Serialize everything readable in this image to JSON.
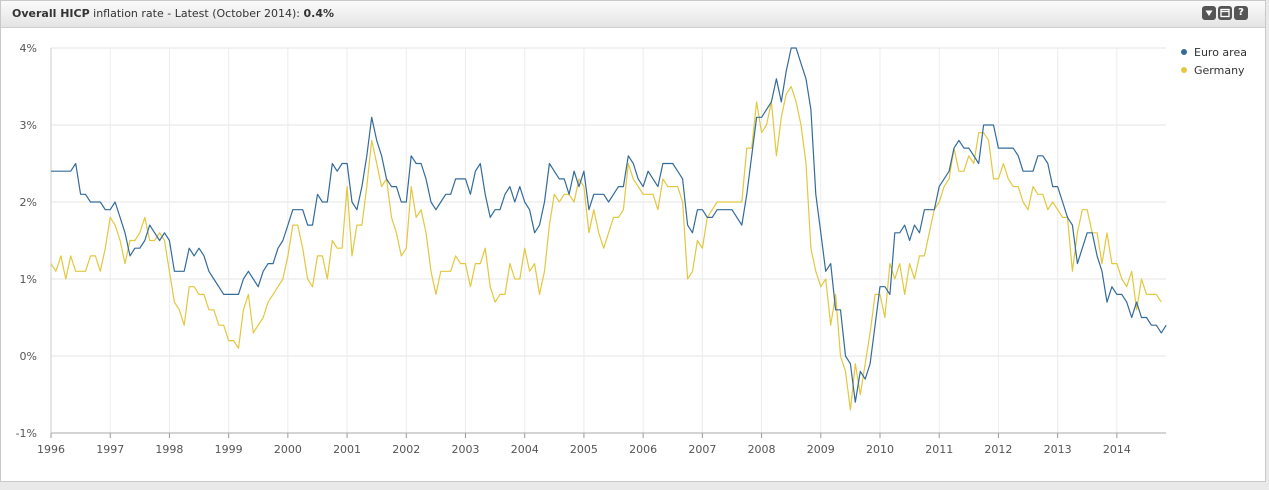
{
  "header": {
    "title_bold": "Overall HICP",
    "title_rest": " inflation rate - Latest (October 2014): ",
    "latest_value": "0.4%",
    "buttons": {
      "menu": "menu-icon",
      "window": "window-icon",
      "help": "?"
    }
  },
  "chart_data": {
    "type": "line",
    "title": "",
    "xlabel": "",
    "ylabel": "",
    "x_start": "1996-01",
    "x_end": "2014-10",
    "x_interval": "monthly",
    "xlim": [
      1996,
      2014.83
    ],
    "ylim": [
      -1,
      4
    ],
    "y_ticks": [
      "-1%",
      "0%",
      "1%",
      "2%",
      "3%",
      "4%"
    ],
    "x_ticks": [
      "1996",
      "1997",
      "1998",
      "1999",
      "2000",
      "2001",
      "2002",
      "2003",
      "2004",
      "2005",
      "2006",
      "2007",
      "2008",
      "2009",
      "2010",
      "2011",
      "2012",
      "2013",
      "2014"
    ],
    "grid": true,
    "legend_position": "top-right",
    "series": [
      {
        "name": "Euro area",
        "color": "#336b9b",
        "values": [
          2.4,
          2.4,
          2.4,
          2.4,
          2.4,
          2.5,
          2.1,
          2.1,
          2.0,
          2.0,
          2.0,
          1.9,
          1.9,
          2.0,
          1.8,
          1.6,
          1.3,
          1.4,
          1.4,
          1.5,
          1.7,
          1.6,
          1.5,
          1.6,
          1.5,
          1.1,
          1.1,
          1.1,
          1.4,
          1.3,
          1.4,
          1.3,
          1.1,
          1.0,
          0.9,
          0.8,
          0.8,
          0.8,
          0.8,
          1.0,
          1.1,
          1.0,
          0.9,
          1.1,
          1.2,
          1.2,
          1.4,
          1.5,
          1.7,
          1.9,
          1.9,
          1.9,
          1.7,
          1.7,
          2.1,
          2.0,
          2.0,
          2.5,
          2.4,
          2.5,
          2.5,
          2.0,
          1.9,
          2.2,
          2.6,
          3.1,
          2.8,
          2.6,
          2.3,
          2.2,
          2.2,
          2.0,
          2.0,
          2.6,
          2.5,
          2.5,
          2.3,
          2.0,
          1.9,
          2.0,
          2.1,
          2.1,
          2.3,
          2.3,
          2.3,
          2.1,
          2.4,
          2.5,
          2.1,
          1.8,
          1.9,
          1.9,
          2.1,
          2.2,
          2.0,
          2.2,
          2.0,
          1.9,
          1.6,
          1.7,
          2.0,
          2.5,
          2.4,
          2.3,
          2.3,
          2.1,
          2.4,
          2.2,
          2.4,
          1.9,
          2.1,
          2.1,
          2.1,
          2.0,
          2.1,
          2.2,
          2.2,
          2.6,
          2.5,
          2.3,
          2.2,
          2.4,
          2.3,
          2.2,
          2.5,
          2.5,
          2.5,
          2.4,
          2.3,
          1.7,
          1.6,
          1.9,
          1.9,
          1.8,
          1.8,
          1.9,
          1.9,
          1.9,
          1.9,
          1.8,
          1.7,
          2.1,
          2.6,
          3.1,
          3.1,
          3.2,
          3.3,
          3.6,
          3.3,
          3.7,
          4.0,
          4.0,
          3.8,
          3.6,
          3.2,
          2.1,
          1.6,
          1.1,
          1.2,
          0.6,
          0.6,
          0.0,
          -0.1,
          -0.6,
          -0.2,
          -0.3,
          -0.1,
          0.4,
          0.9,
          0.9,
          0.8,
          1.6,
          1.6,
          1.7,
          1.5,
          1.7,
          1.6,
          1.9,
          1.9,
          1.9,
          2.2,
          2.3,
          2.4,
          2.7,
          2.8,
          2.7,
          2.7,
          2.6,
          2.5,
          3.0,
          3.0,
          3.0,
          2.7,
          2.7,
          2.7,
          2.7,
          2.6,
          2.4,
          2.4,
          2.4,
          2.6,
          2.6,
          2.5,
          2.2,
          2.2,
          2.0,
          1.8,
          1.7,
          1.2,
          1.4,
          1.6,
          1.6,
          1.3,
          1.1,
          0.7,
          0.9,
          0.8,
          0.8,
          0.7,
          0.5,
          0.7,
          0.5,
          0.5,
          0.4,
          0.4,
          0.3,
          0.4
        ]
      },
      {
        "name": "Germany",
        "color": "#e3c73f",
        "values": [
          1.2,
          1.1,
          1.3,
          1.0,
          1.3,
          1.1,
          1.1,
          1.1,
          1.3,
          1.3,
          1.1,
          1.4,
          1.8,
          1.7,
          1.5,
          1.2,
          1.5,
          1.5,
          1.6,
          1.8,
          1.5,
          1.5,
          1.6,
          1.5,
          1.1,
          0.7,
          0.6,
          0.4,
          0.9,
          0.9,
          0.8,
          0.8,
          0.6,
          0.6,
          0.4,
          0.4,
          0.2,
          0.2,
          0.1,
          0.6,
          0.8,
          0.3,
          0.4,
          0.5,
          0.7,
          0.8,
          0.9,
          1.0,
          1.3,
          1.7,
          1.7,
          1.4,
          1.0,
          0.9,
          1.3,
          1.3,
          1.0,
          1.5,
          1.4,
          1.4,
          2.2,
          1.3,
          1.7,
          1.7,
          2.2,
          2.8,
          2.5,
          2.2,
          2.3,
          1.8,
          1.6,
          1.3,
          1.4,
          2.2,
          1.8,
          1.9,
          1.6,
          1.1,
          0.8,
          1.1,
          1.1,
          1.1,
          1.3,
          1.2,
          1.2,
          0.9,
          1.2,
          1.2,
          1.4,
          0.9,
          0.7,
          0.8,
          0.8,
          1.2,
          1.0,
          1.0,
          1.4,
          1.1,
          1.2,
          0.8,
          1.1,
          1.7,
          2.1,
          2.0,
          2.1,
          2.1,
          2.0,
          2.3,
          2.2,
          1.6,
          1.9,
          1.6,
          1.4,
          1.6,
          1.8,
          1.8,
          1.9,
          2.5,
          2.3,
          2.2,
          2.1,
          2.1,
          2.1,
          1.9,
          2.3,
          2.2,
          2.2,
          2.2,
          2.0,
          1.0,
          1.1,
          1.5,
          1.4,
          1.8,
          1.9,
          2.0,
          2.0,
          2.0,
          2.0,
          2.0,
          2.0,
          2.7,
          2.7,
          3.3,
          2.9,
          3.0,
          3.3,
          2.6,
          3.1,
          3.4,
          3.5,
          3.3,
          3.0,
          2.5,
          1.4,
          1.1,
          0.9,
          1.0,
          0.4,
          0.8,
          0.0,
          -0.2,
          -0.7,
          -0.1,
          -0.5,
          -0.1,
          0.3,
          0.8,
          0.8,
          0.5,
          1.2,
          1.0,
          1.2,
          0.8,
          1.2,
          1.0,
          1.3,
          1.3,
          1.6,
          1.9,
          2.0,
          2.2,
          2.3,
          2.7,
          2.4,
          2.4,
          2.6,
          2.5,
          2.9,
          2.9,
          2.8,
          2.3,
          2.3,
          2.5,
          2.3,
          2.2,
          2.2,
          2.0,
          1.9,
          2.2,
          2.1,
          2.1,
          1.9,
          2.0,
          1.9,
          1.8,
          1.8,
          1.1,
          1.6,
          1.9,
          1.9,
          1.6,
          1.6,
          1.2,
          1.6,
          1.2,
          1.2,
          1.0,
          0.9,
          1.1,
          0.6,
          1.0,
          0.8,
          0.8,
          0.8,
          0.7
        ]
      }
    ]
  }
}
